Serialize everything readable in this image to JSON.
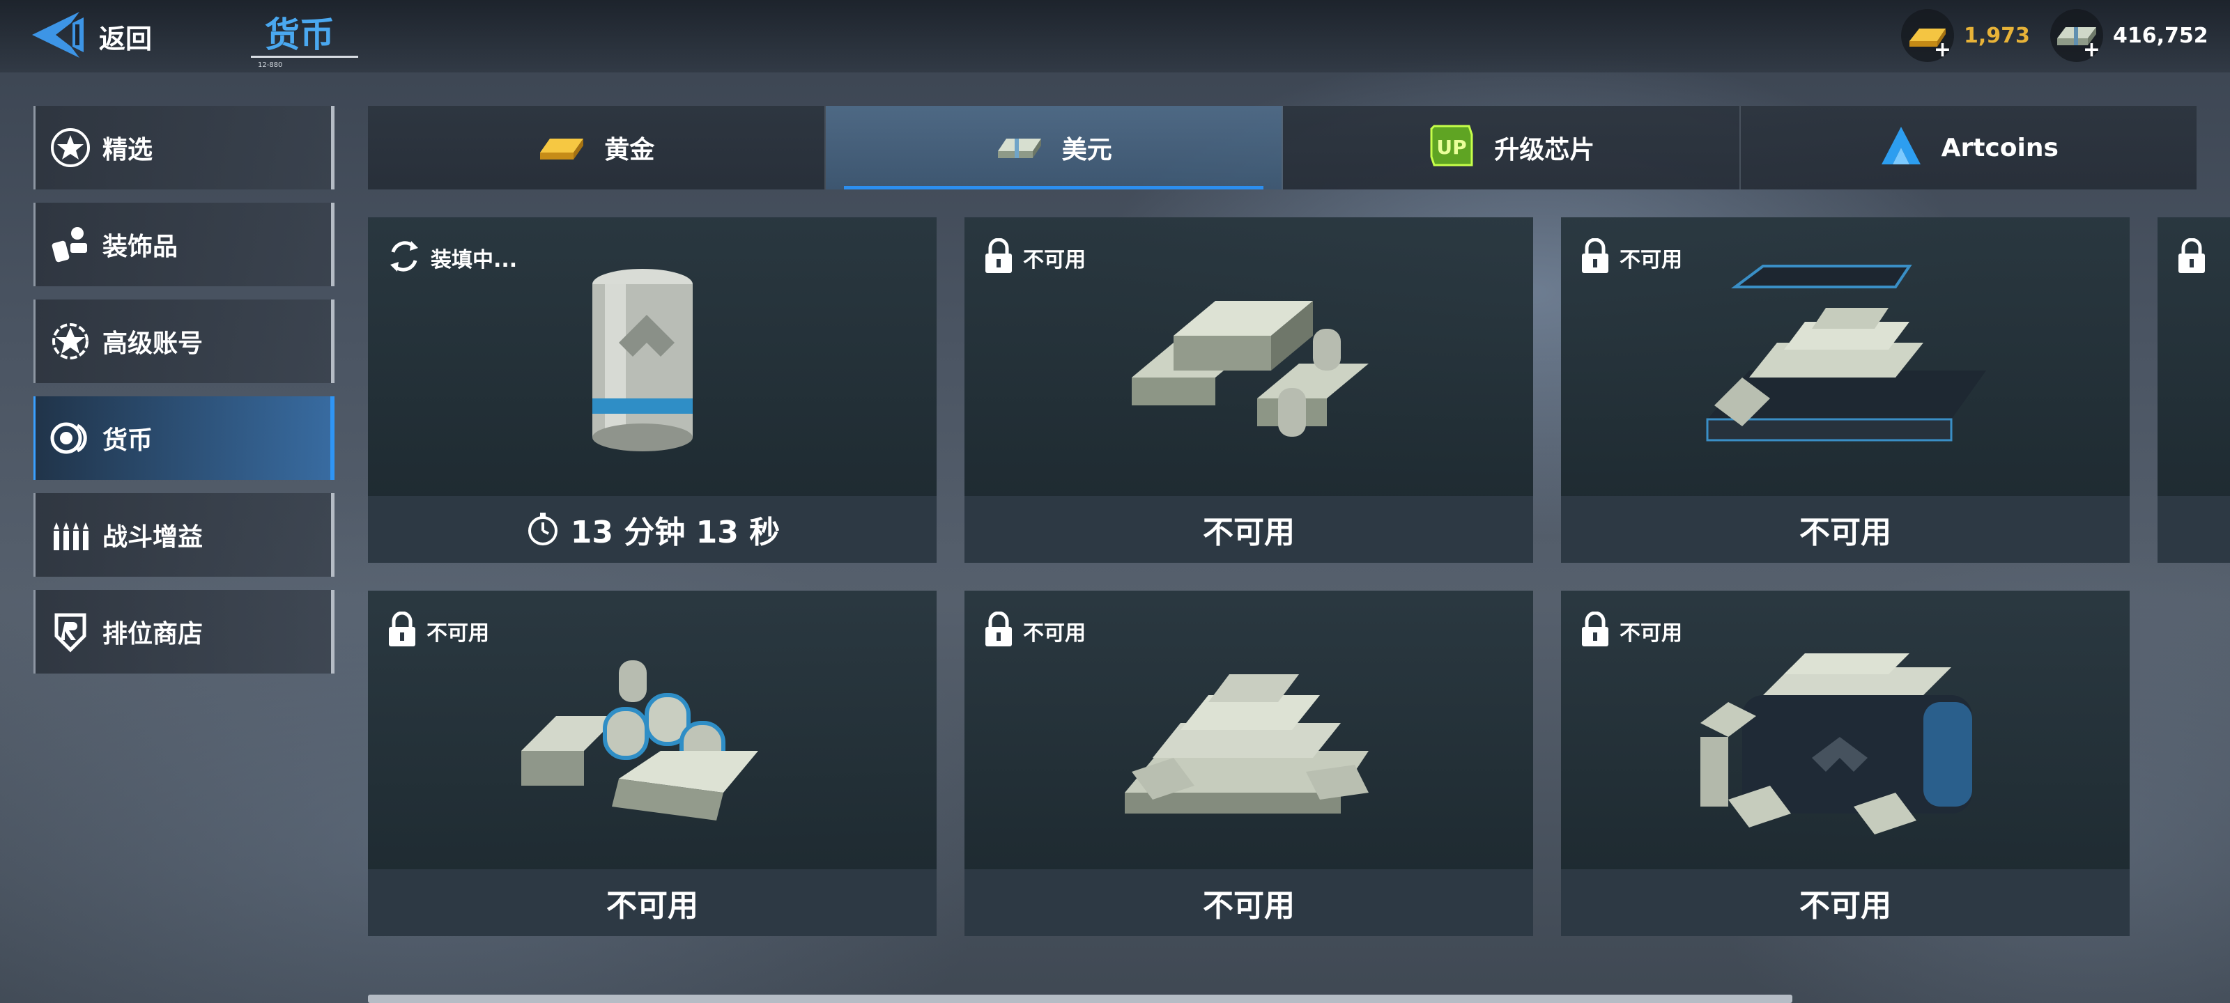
{
  "header": {
    "back_label": "返回",
    "title": "货币",
    "title_sub": "12-880"
  },
  "currencies": {
    "gold": {
      "icon": "gold-bar-icon",
      "value": "1,973",
      "color": "#e8b338"
    },
    "dollars": {
      "icon": "cash-stack-icon",
      "value": "416,752",
      "color": "#ffffff"
    }
  },
  "sidebar": {
    "items": [
      {
        "label": "精选",
        "icon": "star-badge-icon",
        "active": false
      },
      {
        "label": "装饰品",
        "icon": "accessories-icon",
        "active": false
      },
      {
        "label": "高级账号",
        "icon": "premium-star-icon",
        "active": false
      },
      {
        "label": "货币",
        "icon": "coins-icon",
        "active": true
      },
      {
        "label": "战斗增益",
        "icon": "ammo-icon",
        "active": false
      },
      {
        "label": "排位商店",
        "icon": "rank-shield-icon",
        "active": false
      }
    ]
  },
  "tabs": [
    {
      "label": "黄金",
      "icon": "gold-bar-icon",
      "active": false
    },
    {
      "label": "美元",
      "icon": "cash-stack-icon",
      "active": true
    },
    {
      "label": "升级芯片",
      "icon": "upgrade-chip-icon",
      "active": false
    },
    {
      "label": "Artcoins",
      "icon": "artcoin-icon",
      "active": false
    }
  ],
  "cards": [
    {
      "status": "装填中...",
      "status_icon": "refresh-icon",
      "footer": "13 分钟 13 秒",
      "footer_icon": "stopwatch-icon",
      "art": "cash-roll"
    },
    {
      "status": "不可用",
      "status_icon": "lock-icon",
      "footer": "不可用",
      "art": "cash-pile-small"
    },
    {
      "status": "不可用",
      "status_icon": "lock-icon",
      "footer": "不可用",
      "art": "cash-case"
    },
    {
      "status": "不可用",
      "status_icon": "lock-icon",
      "footer": "不可用",
      "art": "cash-rolls-wads"
    },
    {
      "status": "不可用",
      "status_icon": "lock-icon",
      "footer": "不可用",
      "art": "cash-pile-large"
    },
    {
      "status": "不可用",
      "status_icon": "lock-icon",
      "footer": "不可用",
      "art": "cash-bag"
    }
  ],
  "colors": {
    "accent": "#2c8ff0",
    "title": "#4aa8f0",
    "gold_value": "#e8b338"
  }
}
